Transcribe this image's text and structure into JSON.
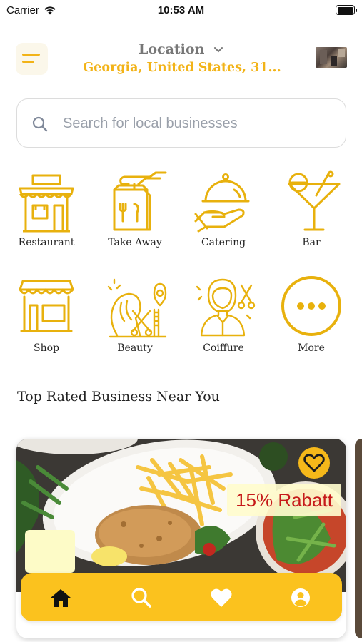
{
  "status_bar": {
    "carrier": "Carrier",
    "time": "10:53 AM"
  },
  "header": {
    "location_label": "Location",
    "location_value": "Georgia, United States, 31..."
  },
  "search": {
    "placeholder": "Search for local businesses",
    "value": ""
  },
  "categories": [
    {
      "label": "Restaurant",
      "icon": "restaurant-icon"
    },
    {
      "label": "Take Away",
      "icon": "take-away-icon"
    },
    {
      "label": "Catering",
      "icon": "catering-icon"
    },
    {
      "label": "Bar",
      "icon": "cocktail-icon"
    },
    {
      "label": "Shop",
      "icon": "shop-icon"
    },
    {
      "label": "Beauty",
      "icon": "beauty-icon"
    },
    {
      "label": "Coiffure",
      "icon": "coiffure-icon"
    },
    {
      "label": "More",
      "icon": "more-icon"
    }
  ],
  "section_title": "Top Rated Business Near You",
  "business_card": {
    "discount_label": "15% Rabatt"
  },
  "tab_bar": {
    "tabs": [
      {
        "name": "home",
        "icon": "home-icon",
        "active": true
      },
      {
        "name": "search",
        "icon": "search-icon",
        "active": false
      },
      {
        "name": "favorites",
        "icon": "heart-icon",
        "active": false
      },
      {
        "name": "profile",
        "icon": "user-icon",
        "active": false
      }
    ]
  },
  "colors": {
    "accent": "#f2b318",
    "tab_bar": "#fbc21e",
    "discount_text": "#c61a1a"
  }
}
